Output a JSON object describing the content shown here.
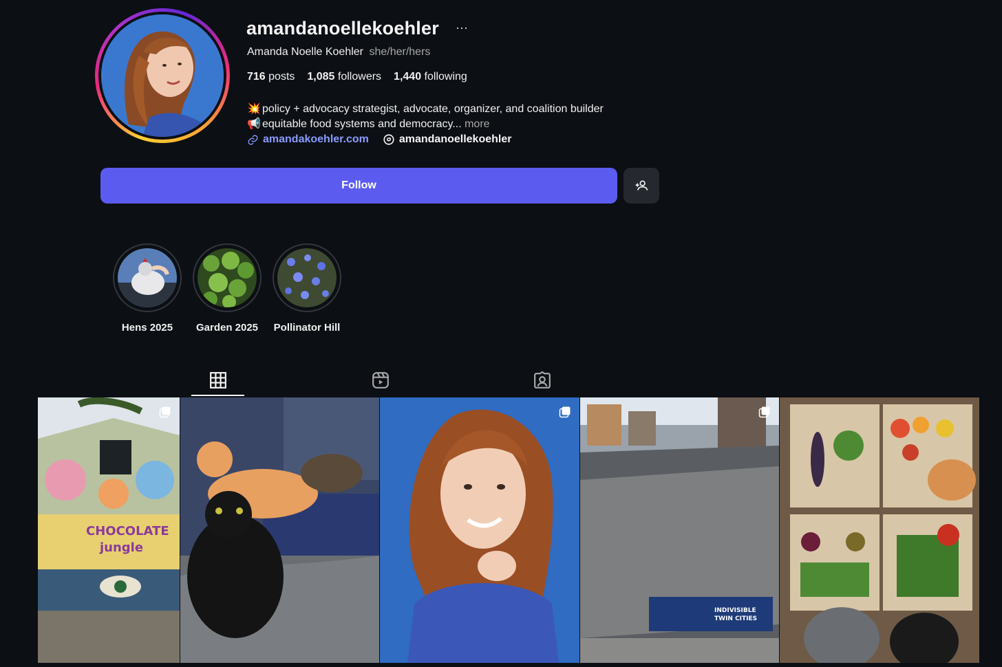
{
  "profile": {
    "username": "amandanoellekoehler",
    "more": "···",
    "full_name": "Amanda Noelle Koehler",
    "pronouns": "she/her/hers",
    "stats": {
      "posts_count": "716",
      "posts_label": "posts",
      "followers_count": "1,085",
      "followers_label": "followers",
      "following_count": "1,440",
      "following_label": "following"
    },
    "bio": {
      "line1_emoji": "💥",
      "line1": "policy + advocacy strategist, advocate, organizer, and coalition builder",
      "line2_emoji": "📢",
      "line2": "equitable food systems and democracy...",
      "more": "more"
    },
    "website": "amandakoehler.com",
    "threads_handle": "amandanoellekoehler"
  },
  "actions": {
    "follow_label": "Follow"
  },
  "highlights": [
    {
      "label": "Hens 2025",
      "icon": "hen-photo"
    },
    {
      "label": "Garden 2025",
      "icon": "garden-photo"
    },
    {
      "label": "Pollinator Hill",
      "icon": "flowers-photo"
    }
  ],
  "tabs": [
    {
      "name": "posts",
      "icon": "grid-icon",
      "active": true
    },
    {
      "name": "reels",
      "icon": "reels-icon",
      "active": false
    },
    {
      "name": "tagged",
      "icon": "tagged-icon",
      "active": false
    }
  ],
  "posts": [
    {
      "subject": "chocolate-jungle-mural",
      "sign_text": "CHOCOLATE jungle",
      "multi": true
    },
    {
      "subject": "cats-on-blanket",
      "multi": false
    },
    {
      "subject": "portrait",
      "multi": true
    },
    {
      "subject": "march-crowd",
      "banner_text": "INDIVISIBLE TWIN CITIES",
      "multi": true
    },
    {
      "subject": "vegetable-boxes",
      "multi": false
    }
  ],
  "colors": {
    "background": "#0c0f14",
    "follow_button": "#5b5bf0",
    "link": "#8a9bff",
    "muted_text": "#a8a8a8"
  }
}
